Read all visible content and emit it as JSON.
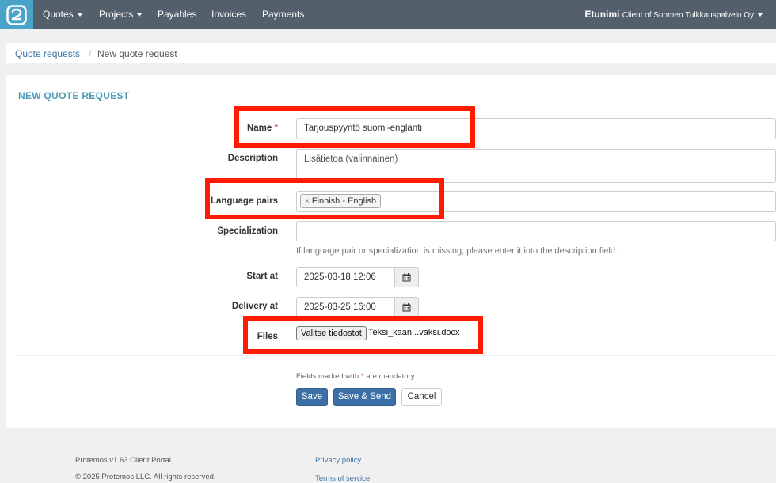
{
  "nav": {
    "logo_icon": "protemos-logo-icon",
    "items": [
      {
        "label": "Quotes",
        "dropdown": true
      },
      {
        "label": "Projects",
        "dropdown": true
      },
      {
        "label": "Payables",
        "dropdown": false
      },
      {
        "label": "Invoices",
        "dropdown": false
      },
      {
        "label": "Payments",
        "dropdown": false
      }
    ],
    "user_name": "Etunimi",
    "user_sub": "Client of Suomen Tulkkauspalvelu Oy"
  },
  "breadcrumb": {
    "parent": "Quote requests",
    "separator": "/",
    "current": "New quote request"
  },
  "form": {
    "title": "NEW QUOTE REQUEST",
    "name_label": "Name",
    "required_mark": "*",
    "name_value": "Tarjouspyyntö suomi-englanti",
    "description_label": "Description",
    "description_placeholder": "Lisätietoa (valinnainen)",
    "language_pairs_label": "Language pairs",
    "language_pair_tag": "Finnish - English",
    "tag_remove": "×",
    "specialization_label": "Specialization",
    "specialization_help": "If language pair or specialization is missing, please enter it into the description field.",
    "start_label": "Start at",
    "start_value": "2025-03-18 12:06",
    "delivery_label": "Delivery at",
    "delivery_value": "2025-03-25 16:00",
    "calendar_icon": "calendar-icon",
    "files_label": "Files",
    "file_button": "Valitse tiedostot",
    "file_name": "Teksi_kaan...vaksi.docx",
    "mandatory_pre": "Fields marked with",
    "mandatory_post": "are mandatory.",
    "save": "Save",
    "save_send": "Save & Send",
    "cancel": "Cancel"
  },
  "footer": {
    "version": "Protemos v1.63 Client Portal.",
    "copyright": "© 2025 Protemos LLC. All rights reserved.",
    "privacy": "Privacy policy",
    "terms": "Terms of service"
  },
  "colors": {
    "navbar": "#53606c",
    "logo_bg": "#4aa3c8",
    "accent_title": "#4a9ab8",
    "primary_button": "#3b6fa6",
    "highlight": "#ff1a00",
    "required": "#d9534f"
  }
}
